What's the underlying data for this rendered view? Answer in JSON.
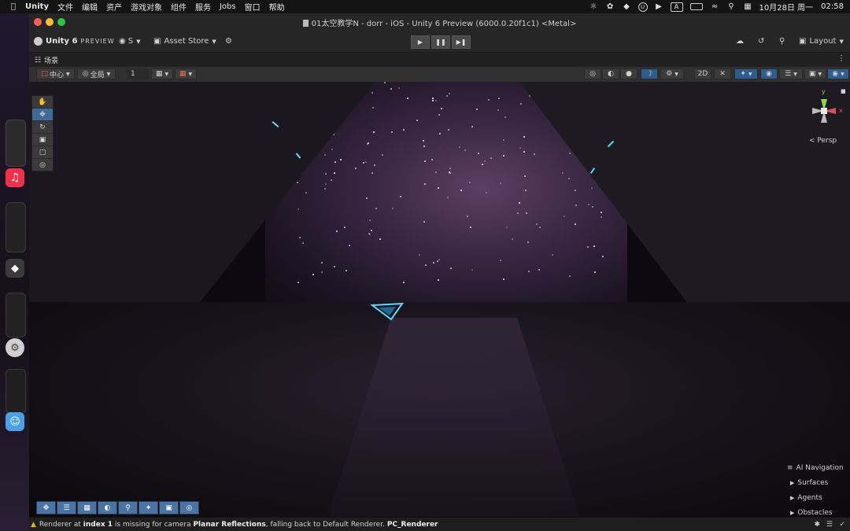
{
  "menubar": {
    "app": "Unity",
    "items": [
      "文件",
      "编辑",
      "资产",
      "游戏对象",
      "组件",
      "服务",
      "Jobs",
      "窗口",
      "帮助"
    ],
    "input_method": "A",
    "clock": "10月28日 周一",
    "time": "02:58"
  },
  "window": {
    "title": "01太空教学N - dorr - iOS - Unity 6 Preview (6000.0.20f1c1) <Metal>"
  },
  "toolbar": {
    "brand": "Unity 6",
    "brand_tag": "PREVIEW",
    "account": "S",
    "asset_store": "Asset Store",
    "layout": "Layout"
  },
  "scene_tab": {
    "label": "场景"
  },
  "overlay": {
    "pivot": "中心",
    "space": "全局",
    "grid_value": "1"
  },
  "viewport": {
    "persp_label": "< Persp",
    "gizmo_y": "y",
    "gizmo_x": "x",
    "ai_nav": {
      "title": "AI Navigation",
      "items": [
        "Surfaces",
        "Agents",
        "Obstacles"
      ]
    }
  },
  "status": {
    "p1": "Renderer at ",
    "b1": "index 1",
    "p2": " is missing for camera ",
    "b2": "Planar Reflections",
    "p3": ", falling back to Default Renderer. ",
    "b3": "PC_Renderer"
  },
  "colors": {
    "accent": "#3e6a98",
    "warning": "#e8b02a"
  }
}
